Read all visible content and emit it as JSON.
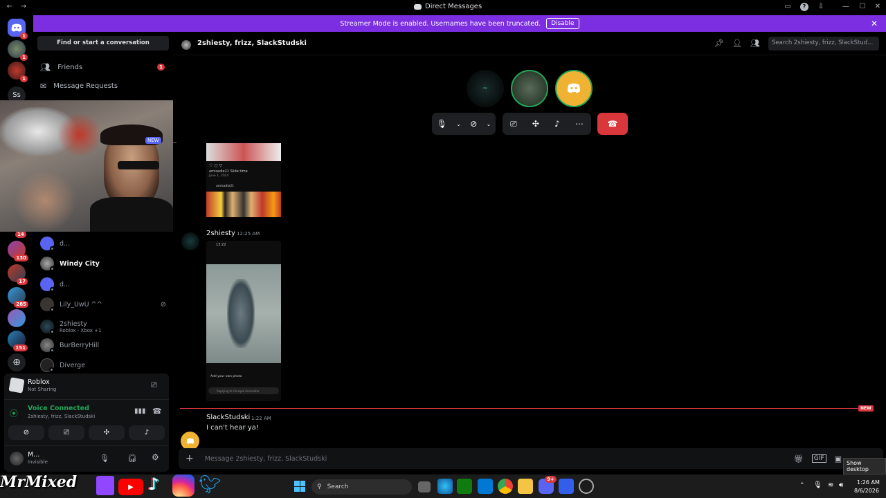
{
  "window": {
    "title": "Direct Messages"
  },
  "banner": {
    "text": "Streamer Mode is enabled. Usernames have been truncated.",
    "button": "Disable"
  },
  "guilds": {
    "badges": [
      "1",
      "1",
      "1",
      "14",
      "130",
      "17",
      "285",
      "151"
    ],
    "ss": "Ss"
  },
  "sidebar": {
    "find": "Find or start a conversation",
    "friends": "Friends",
    "friends_badge": "1",
    "requests": "Message Requests",
    "new_tag": "NEW",
    "dms": [
      {
        "name": "d...",
        "sub": ""
      },
      {
        "name": "Windy City",
        "sub": ""
      },
      {
        "name": "d...",
        "sub": ""
      },
      {
        "name": "Lily_UwU ^^",
        "sub": ""
      },
      {
        "name": "2shiesty",
        "sub": "Roblox - Xbox +1"
      },
      {
        "name": "BurBerryHill",
        "sub": ""
      },
      {
        "name": "Diverge",
        "sub": ""
      }
    ]
  },
  "activity": {
    "game": "Roblox",
    "status": "Not Sharing"
  },
  "voice": {
    "status": "Voice Connected",
    "channel": "2shiesty, frizz, SlackStudski"
  },
  "user": {
    "name": "M...",
    "status": "Invisible"
  },
  "chat": {
    "header": "2shiesty, frizz, SlackStudski",
    "search_placeholder": "Search 2shiesty, frizz, SlackStud...",
    "post1": {
      "caption": "amisadie21 Slide time",
      "date": "June 1, 2024",
      "user": "amisadie21"
    },
    "msg1": {
      "author": "2shiesty",
      "time": "12:25 AM",
      "phone_time": "13:22",
      "phone_caption": "Add your own photo",
      "phone_reply": "Replying to Chrispie Encounter"
    },
    "divider": "NEW",
    "msg2": {
      "author": "SlackStudski",
      "time": "1:22 AM",
      "text": "I can't hear ya!"
    },
    "input_placeholder": "Message 2shiesty, frizz, SlackStudski"
  },
  "overlay": {
    "brand": "MrMixed",
    "tooltip": "Show desktop"
  },
  "taskbar": {
    "search": "Search",
    "time": "1:26 AM",
    "date": "8/6/2026",
    "edge_badge": "9+"
  },
  "colors": {
    "accent": "#7b2fe0",
    "danger": "#da373c",
    "blurple": "#5865f2",
    "voice_green": "#23a55a",
    "discord_yellow": "#f0b232"
  }
}
